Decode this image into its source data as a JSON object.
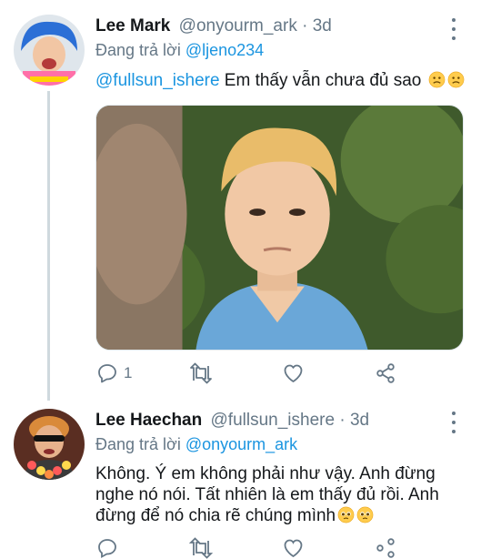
{
  "tweets": [
    {
      "display_name": "Lee Mark",
      "handle": "@onyourm_ark",
      "time": "3d",
      "replying_prefix": "Đang trả lời ",
      "replying_to": "@ljeno234",
      "mention": "@fullsun_ishere",
      "text": " Em thấy vẫn chưa đủ sao",
      "emoji": "confused-face-emoji",
      "actions": {
        "reply_count": "1",
        "retweet_count": "",
        "like_count": ""
      }
    },
    {
      "display_name": "Lee Haechan",
      "handle": "@fullsun_ishere",
      "time": "3d",
      "replying_prefix": "Đang trả lời ",
      "replying_to": "@onyourm_ark",
      "text_lines": [
        "Không. Ý em không phải như vậy. Anh đừng",
        "nghe nó nói. Tất nhiên là em thấy đủ rồi. Anh",
        "đừng để nó chia rẽ chúng mình"
      ],
      "emoji": "pleading-face-emoji"
    }
  ],
  "separator": " · ",
  "colors": {
    "link": "#1b95e0",
    "muted": "#657786",
    "text": "#14171a",
    "thread_line": "#cfd9de"
  },
  "icons": [
    "reply-icon",
    "retweet-icon",
    "like-icon",
    "share-icon",
    "more-icon"
  ]
}
